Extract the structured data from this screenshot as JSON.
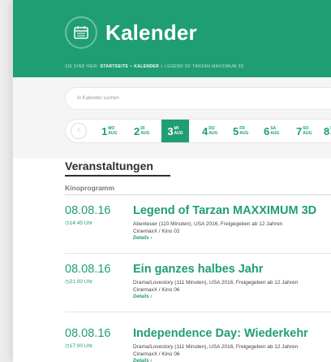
{
  "header": {
    "title": "Kalender",
    "breadcrumb": {
      "prefix": "SIE SIND HIER:",
      "items": [
        "STARTSEITE",
        "KALENDER",
        "LEGEND OF TARZAN MAXXIMUM 3D"
      ],
      "separator": ">"
    }
  },
  "search": {
    "placeholder": "In Kalender suchen"
  },
  "dates": [
    {
      "num": "1",
      "weekday": "MO",
      "month": "AUG",
      "selected": false
    },
    {
      "num": "2",
      "weekday": "DI",
      "month": "AUG",
      "selected": false
    },
    {
      "num": "3",
      "weekday": "MI",
      "month": "AUG",
      "selected": true
    },
    {
      "num": "4",
      "weekday": "DO",
      "month": "AUG",
      "selected": false
    },
    {
      "num": "5",
      "weekday": "FR",
      "month": "AUG",
      "selected": false
    },
    {
      "num": "6",
      "weekday": "SA",
      "month": "AUG",
      "selected": false
    },
    {
      "num": "7",
      "weekday": "SO",
      "month": "AUG",
      "selected": false
    },
    {
      "num": "8",
      "weekday": "MO",
      "month": "AUG",
      "selected": false
    }
  ],
  "section": {
    "title": "Veranstaltungen",
    "category": "Kinoprogramm"
  },
  "events": [
    {
      "date": "08.08.16",
      "time": "14:45 Uhr",
      "title": "Legend of Tarzan MAXXIMUM 3D",
      "meta": "Abenteuer (110 Minuten), USA 2016, Freigegeben ab 12 Jahren",
      "venue": "CinemaxX / Kino 02",
      "details": "Details ›"
    },
    {
      "date": "08.08.16",
      "time": "21:00 Uhr",
      "title": "Ein ganzes halbes Jahr",
      "meta": "Drama/Lovestory (111 Minuten), USA 2016, Freigegeben ab 12 Jahren",
      "venue": "CinemaxX / Kino 06",
      "details": "Details ›"
    },
    {
      "date": "08.08.16",
      "time": "17:00 Uhr",
      "title": "Independence Day: Wiederkehr",
      "meta": "Drama/Lovestory (111 Minuten), USA 2016, Freigegeben ab 12 Jahren",
      "venue": "CinemaxX / Kino 06",
      "details": "Details ›"
    }
  ],
  "colors": {
    "accent": "#1f9e73",
    "page_bg": "#ececec",
    "band_bg": "#f5f5f5"
  },
  "icons": {
    "calendar": "calendar-icon",
    "clock": "clock-icon",
    "prev": "chevron-left-icon"
  }
}
